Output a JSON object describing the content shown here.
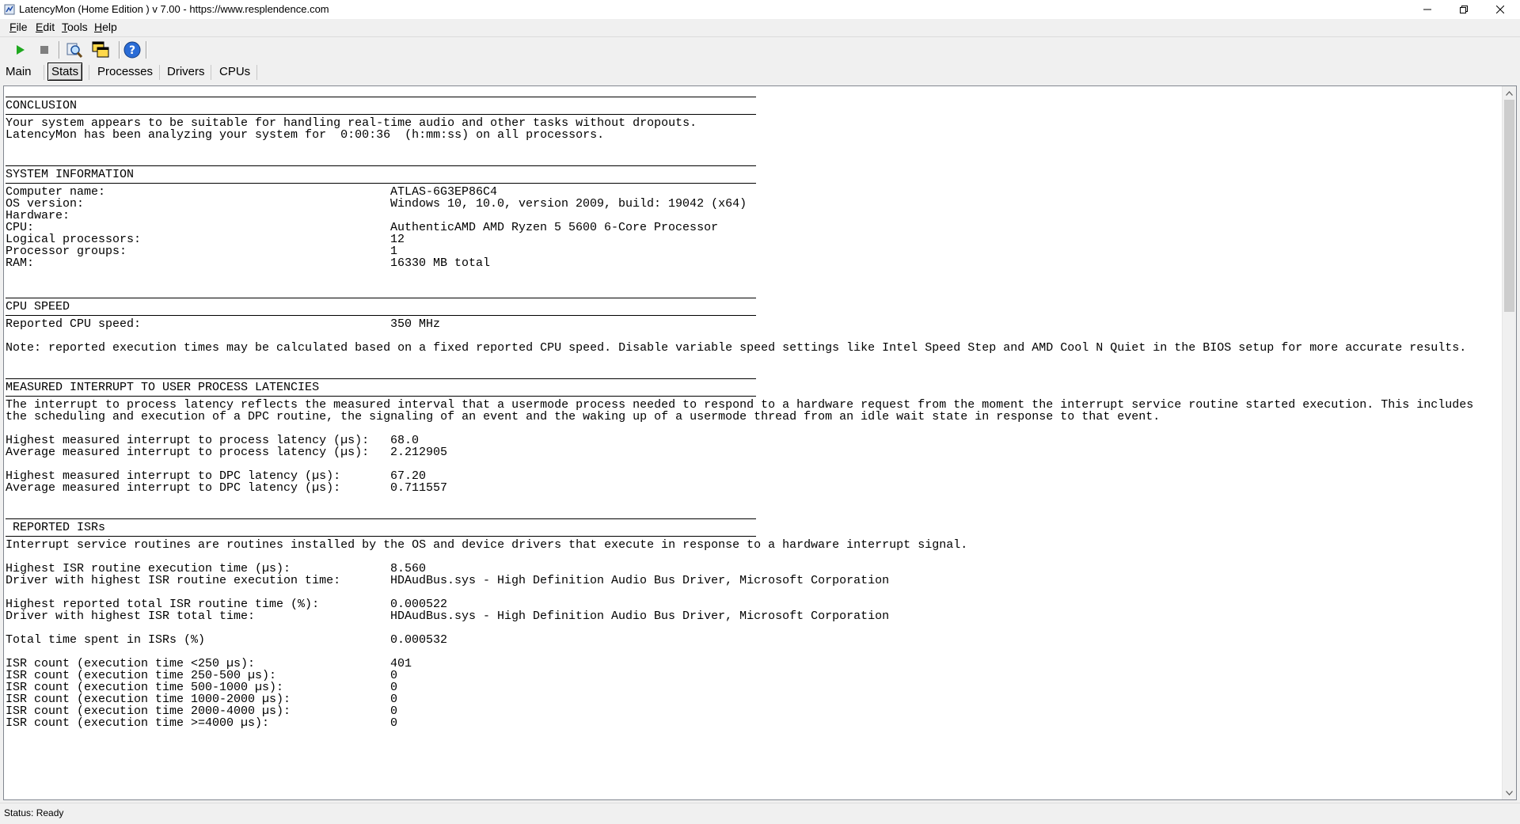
{
  "window": {
    "title": "LatencyMon  (Home Edition )  v 7.00 - https://www.resplendence.com"
  },
  "menu": [
    {
      "label": "File",
      "accel": "F",
      "rest": "ile"
    },
    {
      "label": "Edit",
      "accel": "E",
      "rest": "dit"
    },
    {
      "label": "Tools",
      "accel": "T",
      "rest": "ools"
    },
    {
      "label": "Help",
      "accel": "H",
      "rest": "elp"
    }
  ],
  "toolbar": {
    "icons": [
      "play-icon",
      "stop-icon",
      "search-drivers-icon",
      "windows-icon",
      "help-icon"
    ],
    "colors": {
      "play": "#1fa81f",
      "stop": "#7f7f7f",
      "help": "#2a6cd6"
    }
  },
  "tabs": [
    "Main",
    "Stats",
    "Processes",
    "Drivers",
    "CPUs"
  ],
  "active_tab": "Stats",
  "report": {
    "conclusion": {
      "heading": "CONCLUSION",
      "lines": [
        "Your system appears to be suitable for handling real-time audio and other tasks without dropouts.",
        "LatencyMon has been analyzing your system for  0:00:36  (h:mm:ss) on all processors."
      ]
    },
    "system_information": {
      "heading": "SYSTEM INFORMATION",
      "rows": [
        {
          "label": "Computer name:",
          "value": "ATLAS-6G3EP86C4"
        },
        {
          "label": "OS version:",
          "value": "Windows 10, 10.0, version 2009, build: 19042 (x64)"
        },
        {
          "label": "Hardware:",
          "value": ""
        },
        {
          "label": "CPU:",
          "value": "AuthenticAMD AMD Ryzen 5 5600 6-Core Processor"
        },
        {
          "label": "Logical processors:",
          "value": "12"
        },
        {
          "label": "Processor groups:",
          "value": "1"
        },
        {
          "label": "RAM:",
          "value": "16330 MB total"
        }
      ]
    },
    "cpu_speed": {
      "heading": "CPU SPEED",
      "reported_label": "Reported CPU speed:",
      "reported_value": "350 MHz",
      "note": "Note: reported execution times may be calculated based on a fixed reported CPU speed. Disable variable speed settings like Intel Speed Step and AMD Cool N Quiet in the BIOS setup for more accurate results."
    },
    "latencies": {
      "heading": "MEASURED INTERRUPT TO USER PROCESS LATENCIES",
      "description": [
        "The interrupt to process latency reflects the measured interval that a usermode process needed to respond to a hardware request from the moment the interrupt service routine started execution. This includes",
        "the scheduling and execution of a DPC routine, the signaling of an event and the waking up of a usermode thread from an idle wait state in response to that event."
      ],
      "group1": [
        {
          "label": "Highest measured interrupt to process latency (µs):",
          "value": "68.0"
        },
        {
          "label": "Average measured interrupt to process latency (µs):",
          "value": "2.212905"
        }
      ],
      "group2": [
        {
          "label": "Highest measured interrupt to DPC latency (µs):",
          "value": "67.20"
        },
        {
          "label": "Average measured interrupt to DPC latency (µs):",
          "value": "0.711557"
        }
      ]
    },
    "isrs": {
      "heading": " REPORTED ISRs",
      "description": "Interrupt service routines are routines installed by the OS and device drivers that execute in response to a hardware interrupt signal.",
      "group1": [
        {
          "label": "Highest ISR routine execution time (µs):",
          "value": "8.560"
        },
        {
          "label": "Driver with highest ISR routine execution time:",
          "value": "HDAudBus.sys - High Definition Audio Bus Driver, Microsoft Corporation"
        }
      ],
      "group2": [
        {
          "label": "Highest reported total ISR routine time (%):",
          "value": "0.000522"
        },
        {
          "label": "Driver with highest ISR total time:",
          "value": "HDAudBus.sys - High Definition Audio Bus Driver, Microsoft Corporation"
        }
      ],
      "total": {
        "label": "Total time spent in ISRs (%)",
        "value": "0.000532"
      },
      "counts": [
        {
          "label": "ISR count (execution time <250 µs):",
          "value": "401"
        },
        {
          "label": "ISR count (execution time 250-500 µs):",
          "value": "0"
        },
        {
          "label": "ISR count (execution time 500-1000 µs):",
          "value": "0"
        },
        {
          "label": "ISR count (execution time 1000-2000 µs):",
          "value": "0"
        },
        {
          "label": "ISR count (execution time 2000-4000 µs):",
          "value": "0"
        },
        {
          "label": "ISR count (execution time >=4000 µs):",
          "value": "0"
        }
      ]
    }
  },
  "status": "Status: Ready"
}
